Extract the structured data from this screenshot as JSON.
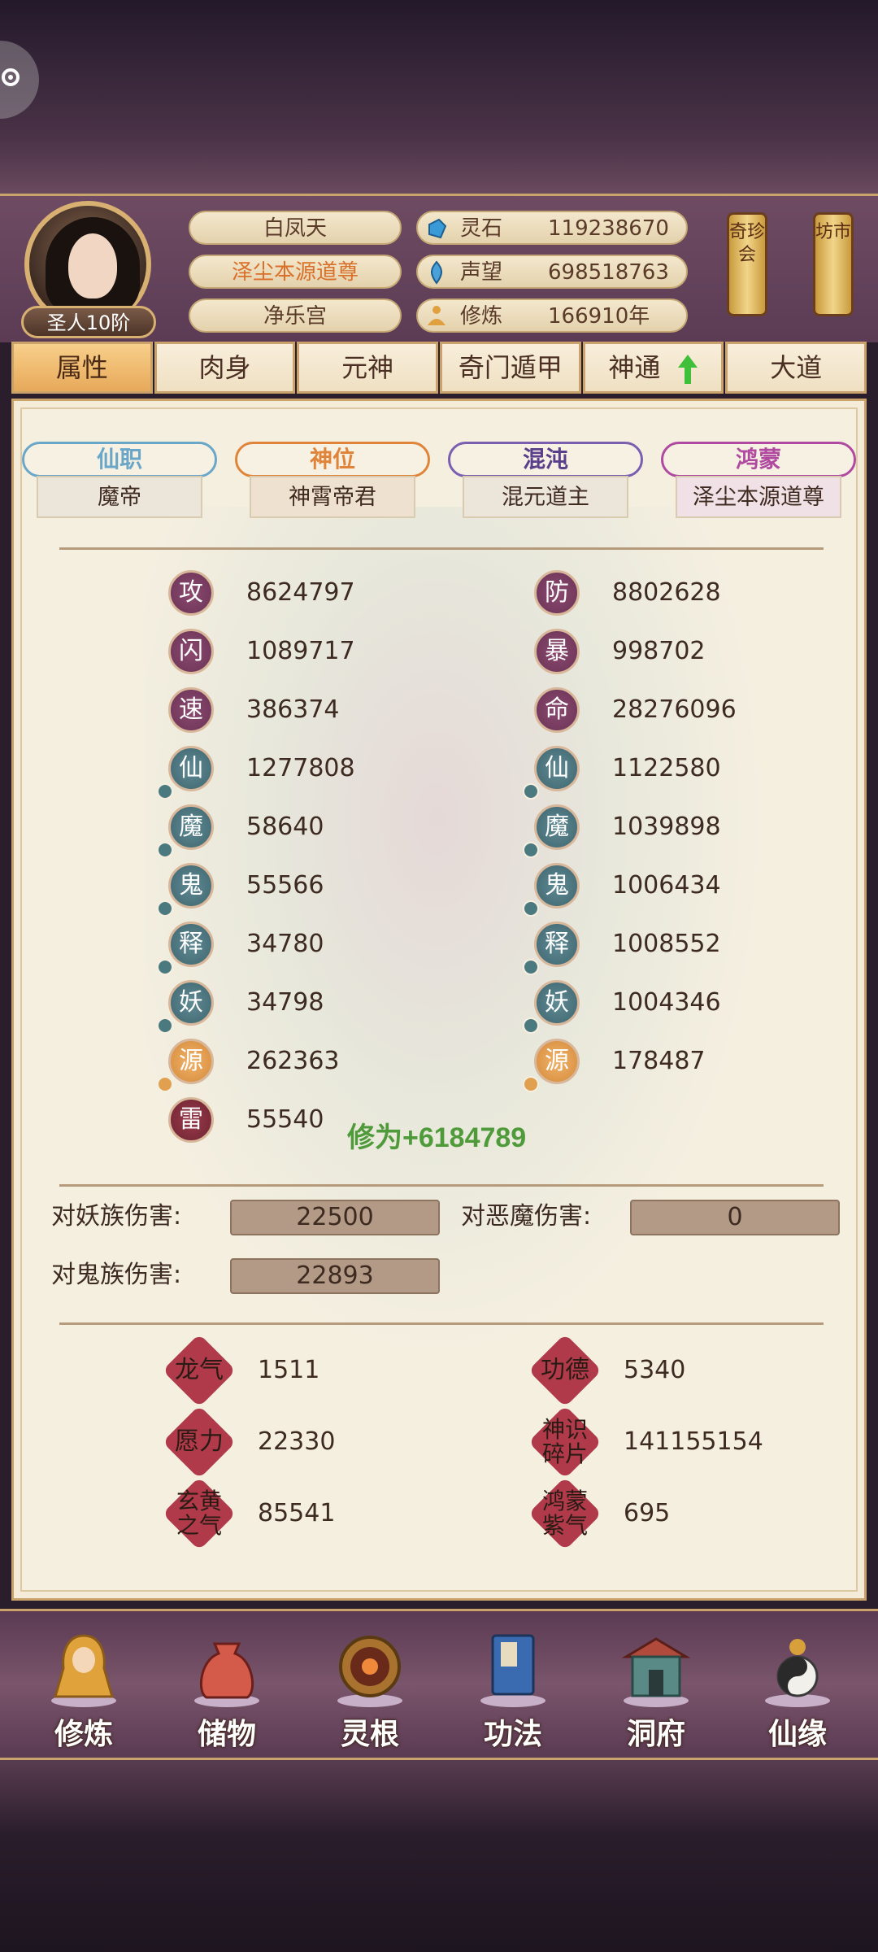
{
  "header": {
    "rank": "圣人10阶",
    "name": "白凤天",
    "title": "泽尘本源道尊",
    "sect": "净乐宫",
    "resources": [
      {
        "label": "灵石",
        "value": "119238670",
        "icon": "spirit-stone-icon"
      },
      {
        "label": "声望",
        "value": "698518763",
        "icon": "reputation-icon"
      },
      {
        "label": "修炼",
        "value": "166910年",
        "icon": "meditation-icon"
      }
    ],
    "lantern_left": "奇珍会",
    "lantern_right": "坊市"
  },
  "tabs": [
    {
      "label": "属性",
      "active": true
    },
    {
      "label": "肉身"
    },
    {
      "label": "元神"
    },
    {
      "label": "奇门遁甲"
    },
    {
      "label": "神通",
      "icon": "green-up-arrow-icon"
    },
    {
      "label": "大道"
    }
  ],
  "ranks": [
    {
      "head": "仙职",
      "value": "魔帝",
      "color": "#6aa6c8"
    },
    {
      "head": "神位",
      "value": "神霄帝君",
      "color": "#e0843a"
    },
    {
      "head": "混沌",
      "value": "混元道主",
      "color": "#7a5fb0"
    },
    {
      "head": "鸿蒙",
      "value": "泽尘本源道尊",
      "color": "#b04aa0"
    }
  ],
  "stats_left": [
    {
      "label": "攻",
      "value": "8624797",
      "style": "purple"
    },
    {
      "label": "闪",
      "value": "1089717",
      "style": "purple"
    },
    {
      "label": "速",
      "value": "386374",
      "style": "purple"
    },
    {
      "label": "仙",
      "value": "1277808",
      "style": "teal"
    },
    {
      "label": "魔",
      "value": "58640",
      "style": "teal"
    },
    {
      "label": "鬼",
      "value": "55566",
      "style": "teal"
    },
    {
      "label": "释",
      "value": "34780",
      "style": "teal"
    },
    {
      "label": "妖",
      "value": "34798",
      "style": "teal"
    },
    {
      "label": "源",
      "value": "262363",
      "style": "gold"
    },
    {
      "label": "雷",
      "value": "55540",
      "style": "red"
    }
  ],
  "stats_right": [
    {
      "label": "防",
      "value": "8802628",
      "style": "purple"
    },
    {
      "label": "暴",
      "value": "998702",
      "style": "purple"
    },
    {
      "label": "命",
      "value": "28276096",
      "style": "purple"
    },
    {
      "label": "仙",
      "value": "1122580",
      "style": "teal"
    },
    {
      "label": "魔",
      "value": "1039898",
      "style": "teal"
    },
    {
      "label": "鬼",
      "value": "1006434",
      "style": "teal"
    },
    {
      "label": "释",
      "value": "1008552",
      "style": "teal"
    },
    {
      "label": "妖",
      "value": "1004346",
      "style": "teal"
    },
    {
      "label": "源",
      "value": "178487",
      "style": "gold"
    }
  ],
  "cultivation_popup": "修为+6184789",
  "damage": {
    "demon_race_label": "对妖族伤害:",
    "demon_race_value": "22500",
    "evil_demon_label": "对恶魔伤害:",
    "evil_demon_value": "0",
    "ghost_race_label": "对鬼族伤害:",
    "ghost_race_value": "22893"
  },
  "special": [
    {
      "label": "龙气",
      "value": "1511"
    },
    {
      "label": "功德",
      "value": "5340"
    },
    {
      "label": "愿力",
      "value": "22330"
    },
    {
      "label": "神识碎片",
      "value": "141155154"
    },
    {
      "label": "玄黄之气",
      "value": "85541"
    },
    {
      "label": "鸿蒙紫气",
      "value": "695"
    }
  ],
  "nav": [
    {
      "label": "修炼",
      "icon": "cultivate-icon"
    },
    {
      "label": "储物",
      "icon": "storage-bag-icon"
    },
    {
      "label": "灵根",
      "icon": "spirit-root-icon"
    },
    {
      "label": "功法",
      "icon": "scripture-book-icon"
    },
    {
      "label": "洞府",
      "icon": "cave-dwelling-icon"
    },
    {
      "label": "仙缘",
      "icon": "immortal-fate-icon"
    }
  ]
}
